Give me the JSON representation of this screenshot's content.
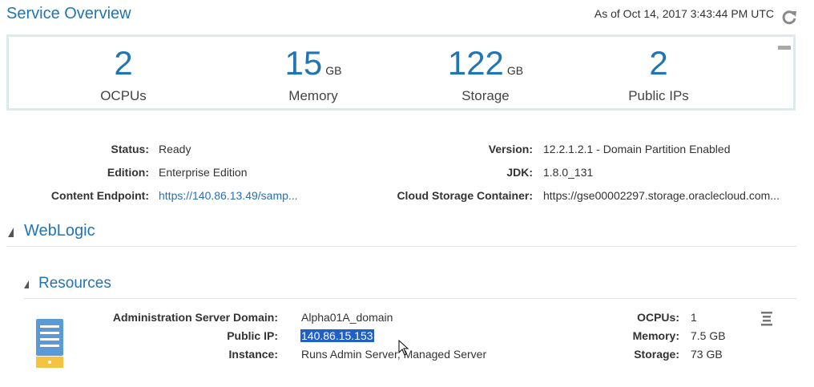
{
  "header": {
    "title": "Service Overview",
    "timestamp": "As of Oct 14, 2017 3:43:44 PM UTC",
    "refresh_icon": "refresh-icon"
  },
  "metrics": [
    {
      "value": "2",
      "unit": "",
      "label": "OCPUs"
    },
    {
      "value": "15",
      "unit": "GB",
      "label": "Memory"
    },
    {
      "value": "122",
      "unit": "GB",
      "label": "Storage"
    },
    {
      "value": "2",
      "unit": "",
      "label": "Public IPs"
    }
  ],
  "details": {
    "status_label": "Status:",
    "status_value": "Ready",
    "edition_label": "Edition:",
    "edition_value": "Enterprise Edition",
    "endpoint_label": "Content Endpoint:",
    "endpoint_value": "https://140.86.13.49/samp...",
    "version_label": "Version:",
    "version_value": "12.2.1.2.1 - Domain Partition Enabled",
    "jdk_label": "JDK:",
    "jdk_value": "1.8.0_131",
    "container_label": "Cloud Storage Container:",
    "container_value": "https://gse00002297.storage.oraclecloud.com..."
  },
  "weblogic": {
    "title": "WebLogic",
    "resources": {
      "title": "Resources",
      "domain_label": "Administration Server Domain:",
      "domain_value": "Alpha01A_domain",
      "ip_label": "Public IP:",
      "ip_value": "140.86.15.153",
      "instance_label": "Instance:",
      "instance_value": "Runs Admin Server, Managed Server",
      "ocpus_label": "OCPUs:",
      "ocpus_value": "1",
      "memory_label": "Memory:",
      "memory_value": "7.5 GB",
      "storage_label": "Storage:",
      "storage_value": "73 GB"
    }
  },
  "colors": {
    "accent": "#2275b3",
    "panel_border": "#dbeaea",
    "server_icon": "#5b9bd5",
    "server_base": "#f5c342"
  }
}
